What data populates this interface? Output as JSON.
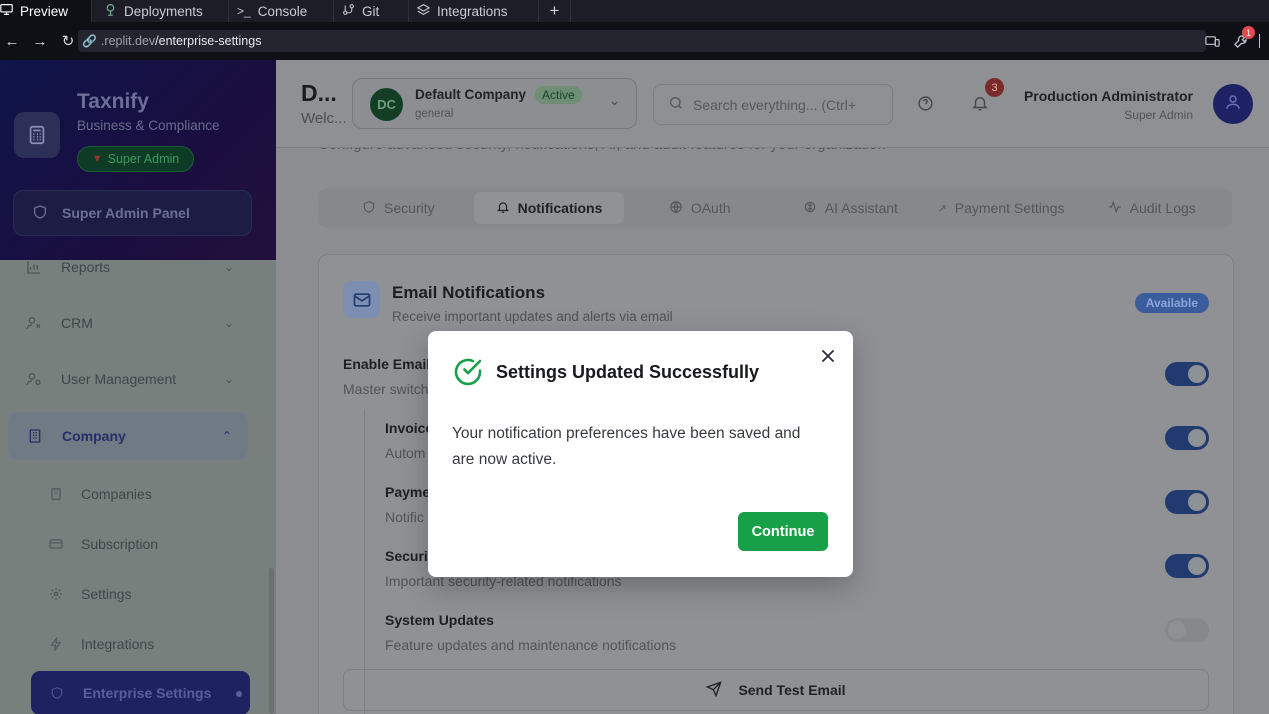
{
  "browser": {
    "tabs": [
      {
        "label": "Preview",
        "icon": "monitor-icon"
      },
      {
        "label": "Deployments",
        "icon": "deploy-icon"
      },
      {
        "label": "Console",
        "icon": "terminal-icon"
      },
      {
        "label": "Git",
        "icon": "git-icon"
      },
      {
        "label": "Integrations",
        "icon": "layers-icon"
      }
    ],
    "new_tab": "+",
    "url_host": ".replit.dev",
    "url_path": "/enterprise-settings",
    "notification_count": "1"
  },
  "sidebar": {
    "brand_title": "Taxnify",
    "brand_subtitle": "Business & Compliance",
    "role_badge": "Super Admin",
    "panel_label": "Super Admin Panel",
    "items": [
      {
        "label": "Reports",
        "icon": "chart-icon"
      },
      {
        "label": "CRM",
        "icon": "users-icon"
      },
      {
        "label": "User Management",
        "icon": "user-cog-icon"
      },
      {
        "label": "Company",
        "icon": "building-icon"
      }
    ],
    "subitems": [
      {
        "label": "Companies",
        "icon": "building-small-icon"
      },
      {
        "label": "Subscription",
        "icon": "card-icon"
      },
      {
        "label": "Settings",
        "icon": "gear-icon"
      },
      {
        "label": "Integrations",
        "icon": "bolt-icon"
      },
      {
        "label": "Enterprise Settings",
        "icon": "shield-icon"
      }
    ]
  },
  "header": {
    "page_initial": "D...",
    "welcome": "Welc...",
    "company": {
      "initials": "DC",
      "name": "Default Company",
      "status": "Active",
      "type": "general"
    },
    "search_placeholder": "Search everything... (Ctrl+",
    "bell_count": "3",
    "admin_name": "Production Administrator",
    "admin_role": "Super Admin"
  },
  "main": {
    "subtitle": "Configure advanced security, notifications, AI, and audit features for your organization",
    "tabs": [
      {
        "label": "Security",
        "icon": "shield-icon"
      },
      {
        "label": "Notifications",
        "icon": "bell-icon"
      },
      {
        "label": "OAuth",
        "icon": "globe-icon"
      },
      {
        "label": "AI Assistant",
        "icon": "brain-icon"
      },
      {
        "label": "Payment Settings",
        "icon": "key-icon"
      },
      {
        "label": "Audit Logs",
        "icon": "activity-icon"
      }
    ],
    "card": {
      "title": "Email Notifications",
      "subtitle": "Receive important updates and alerts via email",
      "badge": "Available",
      "rows": [
        {
          "title": "Enable Email",
          "desc": "Master switch",
          "on": true
        },
        {
          "title": "Invoice",
          "desc": "Autom",
          "on": true
        },
        {
          "title": "Payme",
          "desc": "Notific",
          "on": true
        },
        {
          "title": "Securit",
          "desc": "Important security-related notifications",
          "on": true
        },
        {
          "title": "System Updates",
          "desc": "Feature updates and maintenance notifications",
          "on": false
        }
      ],
      "test_button": "Send Test Email"
    }
  },
  "modal": {
    "title": "Settings Updated Successfully",
    "body": "Your notification preferences have been saved and are now active.",
    "continue": "Continue",
    "accent": "#17a047"
  }
}
